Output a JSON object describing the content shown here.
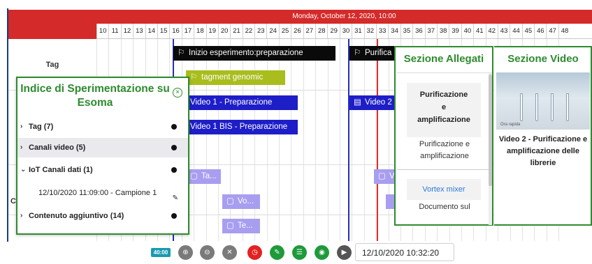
{
  "timeline": {
    "date_label": "Monday, October 12, 2020, 10:00",
    "ticks": [
      "10",
      "11",
      "12",
      "13",
      "14",
      "15",
      "16",
      "17",
      "18",
      "19",
      "20",
      "21",
      "22",
      "23",
      "24",
      "25",
      "26",
      "27",
      "28",
      "29",
      "30",
      "31",
      "32",
      "33",
      "34",
      "35",
      "36",
      "37",
      "38",
      "39",
      "40",
      "41",
      "42",
      "43",
      "44",
      "45",
      "46",
      "47",
      "48"
    ],
    "row_labels": {
      "tag": "Tag",
      "clipped": "C"
    },
    "events": {
      "inizio": "Inizio esperimento:preparazione",
      "purifica": "Purifica",
      "tagment": "tagment genomic",
      "video1": "Video 1 - Preparazione",
      "video2": "Video 2",
      "video1bis": "Video 1 BIS - Preparazione",
      "ta": "Ta...",
      "v": "V",
      "vo": "Vo...",
      "te": "Te..."
    }
  },
  "index_panel": {
    "title": "Indice di Sperimentazione su Esoma",
    "items": [
      {
        "label": "Tag (7)",
        "expanded": false
      },
      {
        "label": "Canali video (5)",
        "expanded": false,
        "selected": true
      },
      {
        "label": "IoT Canali dati (1)",
        "expanded": true
      },
      {
        "label": "Contenuto aggiuntivo (14)",
        "expanded": false
      }
    ],
    "sub_item": "12/10/2020 11:09:00 - Campione 1"
  },
  "allegati_panel": {
    "title": "Sezione Allegati",
    "card1_title": "Purificazione e amplificazione",
    "card1_lines": [
      "Purificazione",
      "e",
      "amplificazione"
    ],
    "card1_sub_lines": [
      "Purificazione e",
      "amplificazione"
    ],
    "card2_title": "Vortex mixer",
    "card2_sub": "Documento sul"
  },
  "video_panel": {
    "title": "Sezione Video",
    "thumb_caption": "Ora rapida",
    "description_lines": [
      "Video 2 - Purificazione e",
      "amplificazione delle",
      "librerie"
    ]
  },
  "toolbar": {
    "time_badge": "40:00",
    "datetime": "12/10/2020 10:32:20",
    "icons": [
      "zoom-in-icon",
      "zoom-out-icon",
      "fit-icon",
      "clock-icon",
      "edit-icon",
      "list-icon",
      "eye-icon",
      "play-icon"
    ]
  },
  "colors": {
    "header_red": "#d42a2a",
    "panel_green": "#2e8b2e",
    "event_blue": "#1e1ec8",
    "event_olive": "#a9bd1d",
    "event_lavender": "#a89ef0",
    "current_time_red": "#e03030"
  }
}
